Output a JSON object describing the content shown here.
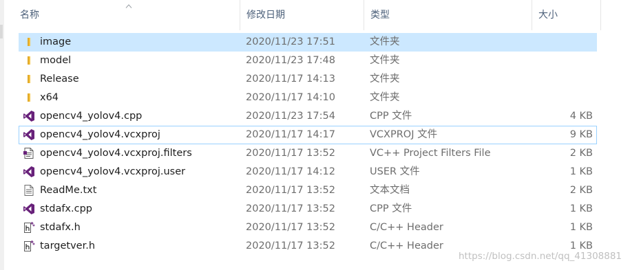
{
  "columns": {
    "name": "名称",
    "date": "修改日期",
    "type": "类型",
    "size": "大小"
  },
  "files": [
    {
      "name": "image",
      "date": "2020/11/23 17:51",
      "type": "文件夹",
      "size": "",
      "icon": "folder-icon",
      "selected": true,
      "focused": false
    },
    {
      "name": "model",
      "date": "2020/11/23 17:48",
      "type": "文件夹",
      "size": "",
      "icon": "folder-icon",
      "selected": false,
      "focused": false
    },
    {
      "name": "Release",
      "date": "2020/11/17 14:13",
      "type": "文件夹",
      "size": "",
      "icon": "folder-icon",
      "selected": false,
      "focused": false
    },
    {
      "name": "x64",
      "date": "2020/11/17 14:10",
      "type": "文件夹",
      "size": "",
      "icon": "folder-icon",
      "selected": false,
      "focused": false
    },
    {
      "name": "opencv4_yolov4.cpp",
      "date": "2020/11/23 17:54",
      "type": "CPP 文件",
      "size": "4 KB",
      "icon": "visual-studio-icon",
      "selected": false,
      "focused": false
    },
    {
      "name": "opencv4_yolov4.vcxproj",
      "date": "2020/11/17 14:17",
      "type": "VCXPROJ 文件",
      "size": "9 KB",
      "icon": "visual-studio-icon",
      "selected": false,
      "focused": true
    },
    {
      "name": "opencv4_yolov4.vcxproj.filters",
      "date": "2020/11/17 13:52",
      "type": "VC++ Project Filters File",
      "size": "2 KB",
      "icon": "filters-file-icon",
      "selected": false,
      "focused": false
    },
    {
      "name": "opencv4_yolov4.vcxproj.user",
      "date": "2020/11/17 14:12",
      "type": "USER 文件",
      "size": "1 KB",
      "icon": "visual-studio-icon",
      "selected": false,
      "focused": false
    },
    {
      "name": "ReadMe.txt",
      "date": "2020/11/17 13:52",
      "type": "文本文档",
      "size": "2 KB",
      "icon": "text-file-icon",
      "selected": false,
      "focused": false
    },
    {
      "name": "stdafx.cpp",
      "date": "2020/11/17 13:52",
      "type": "CPP 文件",
      "size": "1 KB",
      "icon": "visual-studio-icon",
      "selected": false,
      "focused": false
    },
    {
      "name": "stdafx.h",
      "date": "2020/11/17 13:52",
      "type": "C/C++ Header",
      "size": "1 KB",
      "icon": "header-file-icon",
      "selected": false,
      "focused": false
    },
    {
      "name": "targetver.h",
      "date": "2020/11/17 13:52",
      "type": "C/C++ Header",
      "size": "1 KB",
      "icon": "header-file-icon",
      "selected": false,
      "focused": false
    }
  ],
  "watermark": "https://blog.csdn.net/qq_41308881",
  "colors": {
    "selection": "#cce8ff",
    "focus_border": "#99d1ff",
    "folder": "#f5c342",
    "visual_studio": "#68217a"
  }
}
